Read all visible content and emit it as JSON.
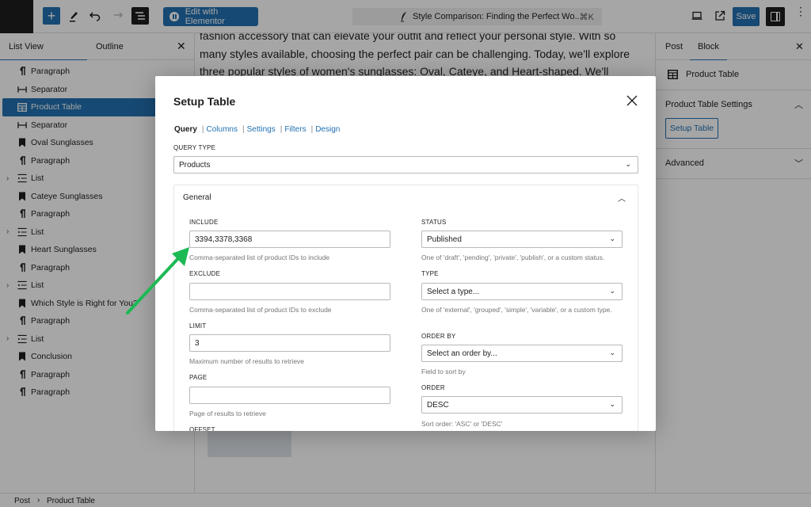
{
  "topbar": {
    "edit_with_elementor_label": "Edit with Elementor",
    "document_title": "Style Comparison: Finding the Perfect Wo...",
    "command_shortcut": "⌘K",
    "save_label": "Save",
    "more_glyph": "⋮",
    "add_glyph": "+"
  },
  "left_panel": {
    "tabs": [
      {
        "label": "List View",
        "active": true
      },
      {
        "label": "Outline",
        "active": false
      }
    ],
    "close_glyph": "✕",
    "items": [
      {
        "label": "Paragraph",
        "icon": "paragraph-icon",
        "glyph": "¶",
        "expandable": false,
        "selected": false
      },
      {
        "label": "Separator",
        "icon": "separator-icon",
        "glyph": "⟝",
        "expandable": false,
        "selected": false
      },
      {
        "label": "Product Table",
        "icon": "table-icon",
        "glyph": "▦",
        "expandable": false,
        "selected": true
      },
      {
        "label": "Separator",
        "icon": "separator-icon",
        "glyph": "⟝",
        "expandable": false,
        "selected": false
      },
      {
        "label": "Oval Sunglasses",
        "icon": "bookmark-icon",
        "glyph": "🔖",
        "expandable": false,
        "selected": false
      },
      {
        "label": "Paragraph",
        "icon": "paragraph-icon",
        "glyph": "¶",
        "expandable": false,
        "selected": false
      },
      {
        "label": "List",
        "icon": "list-icon",
        "glyph": "☰",
        "expandable": true,
        "selected": false
      },
      {
        "label": "Cateye Sunglasses",
        "icon": "bookmark-icon",
        "glyph": "🔖",
        "expandable": false,
        "selected": false
      },
      {
        "label": "Paragraph",
        "icon": "paragraph-icon",
        "glyph": "¶",
        "expandable": false,
        "selected": false
      },
      {
        "label": "List",
        "icon": "list-icon",
        "glyph": "☰",
        "expandable": true,
        "selected": false
      },
      {
        "label": "Heart Sunglasses",
        "icon": "bookmark-icon",
        "glyph": "🔖",
        "expandable": false,
        "selected": false
      },
      {
        "label": "Paragraph",
        "icon": "paragraph-icon",
        "glyph": "¶",
        "expandable": false,
        "selected": false
      },
      {
        "label": "List",
        "icon": "list-icon",
        "glyph": "☰",
        "expandable": true,
        "selected": false
      },
      {
        "label": "Which Style is Right for You?",
        "icon": "bookmark-icon",
        "glyph": "🔖",
        "expandable": false,
        "selected": false
      },
      {
        "label": "Paragraph",
        "icon": "paragraph-icon",
        "glyph": "¶",
        "expandable": false,
        "selected": false
      },
      {
        "label": "List",
        "icon": "list-icon",
        "glyph": "☰",
        "expandable": true,
        "selected": false
      },
      {
        "label": "Conclusion",
        "icon": "bookmark-icon",
        "glyph": "🔖",
        "expandable": false,
        "selected": false
      },
      {
        "label": "Paragraph",
        "icon": "paragraph-icon",
        "glyph": "¶",
        "expandable": false,
        "selected": false
      },
      {
        "label": "Paragraph",
        "icon": "paragraph-icon",
        "glyph": "¶",
        "expandable": false,
        "selected": false
      }
    ]
  },
  "canvas": {
    "paragraph": "fashion accessory that can elevate your outfit and reflect your personal style. With so many styles available, choosing the perfect pair can be challenging. Today, we'll explore three popular styles of women's sunglasses: Oval, Cateye, and Heart-shaped. We'll compare their unique features, best"
  },
  "right_panel": {
    "tabs": [
      {
        "label": "Post",
        "active": false
      },
      {
        "label": "Block",
        "active": true
      }
    ],
    "close_glyph": "✕",
    "block_name": "Product Table",
    "settings_section_title": "Product Table Settings",
    "setup_button_label": "Setup Table",
    "advanced_section_title": "Advanced"
  },
  "footer": {
    "breadcrumb": [
      "Post",
      "Product Table"
    ],
    "separator": "›"
  },
  "modal": {
    "title": "Setup Table",
    "tabs": [
      {
        "label": "Query",
        "active": true
      },
      {
        "label": "Columns",
        "active": false
      },
      {
        "label": "Settings",
        "active": false
      },
      {
        "label": "Filters",
        "active": false
      },
      {
        "label": "Design",
        "active": false
      }
    ],
    "query_type": {
      "label": "QUERY TYPE",
      "value": "Products"
    },
    "general_title": "General",
    "fields": {
      "include": {
        "label": "INCLUDE",
        "value": "3394,3378,3368",
        "help": "Comma-separated list of product IDs to include"
      },
      "exclude": {
        "label": "EXCLUDE",
        "value": "",
        "help": "Comma-separated list of product IDs to exclude"
      },
      "limit": {
        "label": "LIMIT",
        "value": "3",
        "help": "Maximum number of results to retrieve"
      },
      "page": {
        "label": "PAGE",
        "value": "",
        "help": "Page of results to retrieve"
      },
      "offset": {
        "label": "OFFSET"
      },
      "status": {
        "label": "STATUS",
        "value": "Published",
        "help": "One of 'draft', 'pending', 'private', 'publish', or a custom status."
      },
      "type": {
        "label": "TYPE",
        "value": "Select a type...",
        "help": "One of 'external', 'grouped', 'simple', 'variable', or a custom type."
      },
      "order_by": {
        "label": "ORDER BY",
        "value": "Select an order by...",
        "help": "Field to sort by"
      },
      "order": {
        "label": "ORDER",
        "value": "DESC",
        "help": "Sort order: 'ASC' or 'DESC'"
      }
    },
    "pipe": "|"
  },
  "annotation": {
    "arrow_color": "#1db954"
  },
  "colors": {
    "accent": "#2271b1",
    "dark": "#1e1e1e"
  }
}
